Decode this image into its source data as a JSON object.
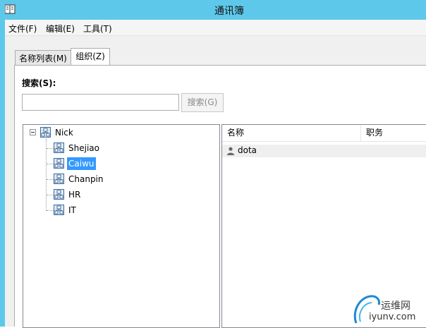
{
  "window": {
    "title": "通讯簿"
  },
  "menu": {
    "items": [
      "文件(F)",
      "编辑(E)",
      "工具(T)"
    ]
  },
  "tabs": [
    {
      "label": "名称列表(M)",
      "active": false
    },
    {
      "label": "组织(Z)",
      "active": true
    }
  ],
  "search": {
    "label": "搜索(S):",
    "value": "",
    "placeholder": "",
    "button_label": "搜索(G)"
  },
  "tree": {
    "root": "Nick",
    "children": [
      "Shejiao",
      "Caiwu",
      "Chanpin",
      "HR",
      "IT"
    ],
    "selected": "Caiwu"
  },
  "list": {
    "columns": [
      "名称",
      "职务"
    ],
    "rows": [
      {
        "name": "dota",
        "title": ""
      }
    ]
  },
  "watermark": {
    "text1": "运维网",
    "text2": "iyunv.com"
  },
  "colors": {
    "titlebar": "#5ec8ea",
    "selection": "#3399ff"
  }
}
